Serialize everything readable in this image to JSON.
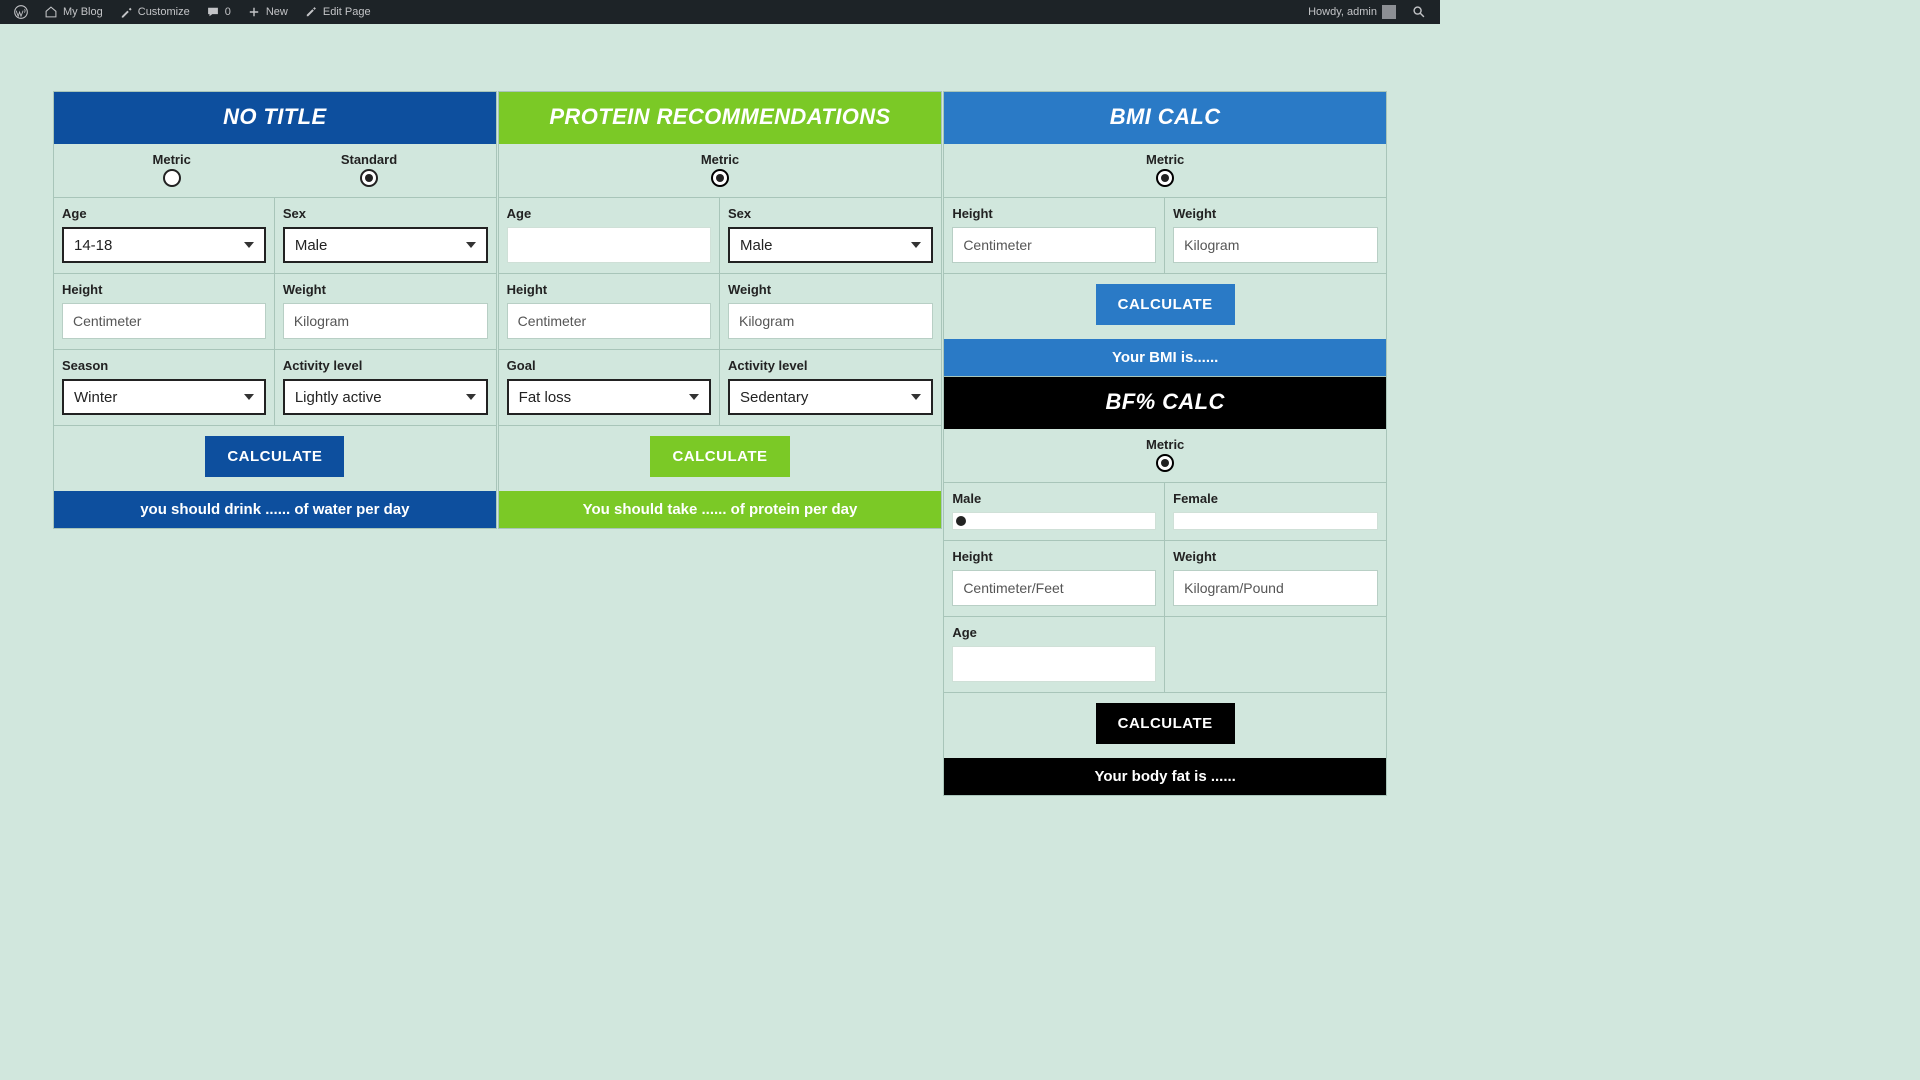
{
  "adminbar": {
    "site": "My Blog",
    "customize": "Customize",
    "comments": "0",
    "new": "New",
    "edit": "Edit Page",
    "greeting": "Howdy, admin"
  },
  "labels": {
    "metric": "Metric",
    "standard": "Standard",
    "age": "Age",
    "sex": "Sex",
    "height": "Height",
    "weight": "Weight",
    "season": "Season",
    "activity": "Activity level",
    "goal": "Goal",
    "calculate": "CALCULATE",
    "male": "Male",
    "female": "Female"
  },
  "placeholders": {
    "cm": "Centimeter",
    "kg": "Kilogram",
    "cmft": "Centimeter/Feet",
    "kglb": "Kilogram/Pound"
  },
  "water": {
    "title": "NO TITLE",
    "age": "14-18",
    "sex": "Male",
    "season": "Winter",
    "activity": "Lightly active",
    "result": "you should drink ...... of water per day"
  },
  "protein": {
    "title": "PROTEIN RECOMMENDATIONS",
    "sex": "Male",
    "goal": "Fat loss",
    "activity": "Sedentary",
    "result": "You should take ...... of protein per day"
  },
  "bmi": {
    "title": "BMI CALC",
    "result": "Your BMI is......"
  },
  "bf": {
    "title": "BF% CALC",
    "result": "Your body fat is ......"
  }
}
